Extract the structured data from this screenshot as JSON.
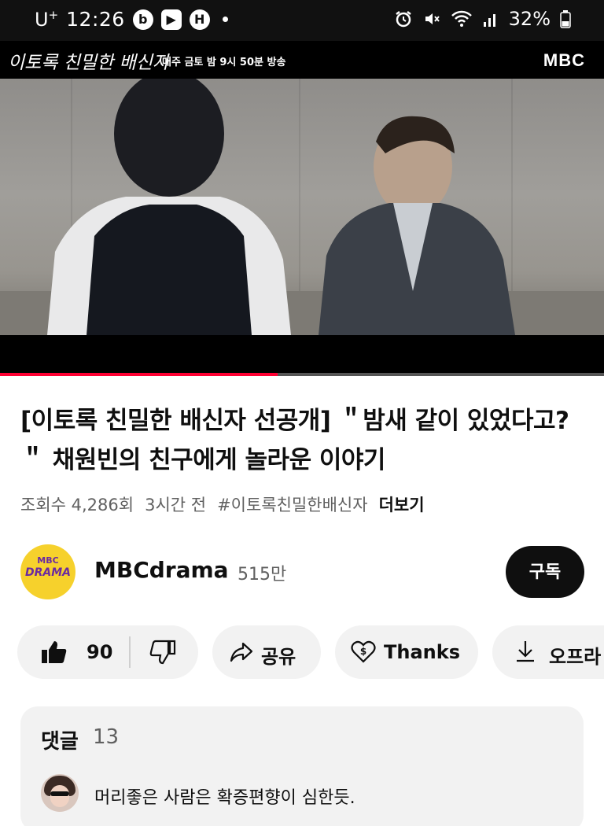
{
  "status_bar": {
    "carrier": "U",
    "carrier_sup": "+",
    "time": "12:26",
    "app_icons": [
      "b-icon",
      "youtube-icon",
      "h-icon"
    ],
    "battery": "32%"
  },
  "video": {
    "show_title": "이토록 친밀한 배신자",
    "broadcast_info": "매주 금토 밤 9시 50분 방송",
    "channel_logo": "MBC",
    "progress": 0.46
  },
  "details": {
    "title": "[이토록 친밀한 배신자 선공개] ＂밤새 같이 있었다고? ＂ 채원빈의 친구에게 놀라운 이야기",
    "views": "조회수 4,286회",
    "time_ago": "3시간 전",
    "hashtag": "#이토록친밀한배신자",
    "more": "더보기"
  },
  "channel": {
    "avatar_top": "MBC",
    "avatar_bottom": "DRAMA",
    "name": "MBCdrama",
    "subscribers": "515만",
    "subscribe_label": "구독"
  },
  "actions": {
    "like_count": "90",
    "share_label": "공유",
    "thanks_label": "Thanks",
    "offline_label": "오프라"
  },
  "comments": {
    "header": "댓글",
    "count": "13",
    "top_comment": "머리좋은 사람은 확증편향이 심한듯."
  },
  "colors": {
    "accent": "#ff0033",
    "subscribe_bg": "#0f0f0f",
    "pill_bg": "#f2f2f2"
  }
}
